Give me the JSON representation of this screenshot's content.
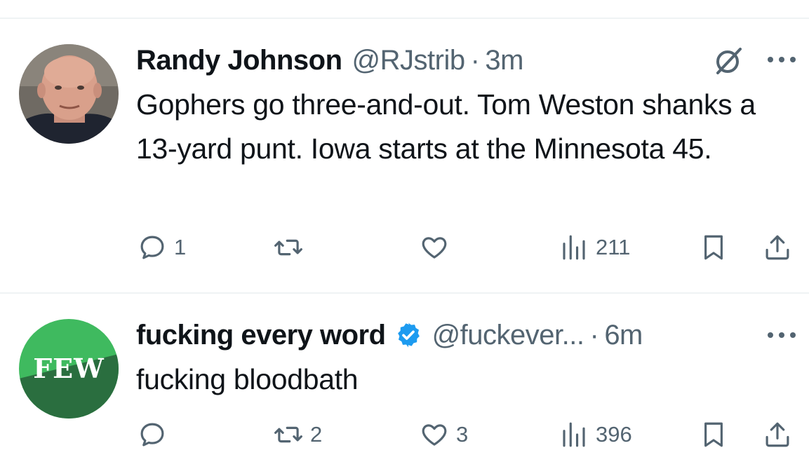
{
  "tweets": [
    {
      "author_name": "Randy Johnson",
      "handle": "@RJstrib",
      "separator": "·",
      "time": "3m",
      "verified": false,
      "avatar_icon": "profile-photo",
      "text": "Gophers go three-and-out. Tom Weston shanks a 13-yard punt. Iowa starts at the Minnesota 45.",
      "actions": {
        "reply_count": "1",
        "retweet_count": "",
        "like_count": "",
        "view_count": "211"
      }
    },
    {
      "author_name": "fucking every word",
      "handle": "@fuckever...",
      "separator": "·",
      "time": "6m",
      "verified": true,
      "avatar_text": "FEW",
      "text": "fucking bloodbath",
      "actions": {
        "reply_count": "",
        "retweet_count": "2",
        "like_count": "3",
        "view_count": "396"
      }
    }
  ],
  "colors": {
    "text_primary": "#0f1419",
    "text_secondary": "#536471",
    "verified_blue": "#1d9bf0",
    "divider": "#eff3f4",
    "few_green_light": "#3fba5f",
    "few_green_dark": "#2a6e3f"
  }
}
